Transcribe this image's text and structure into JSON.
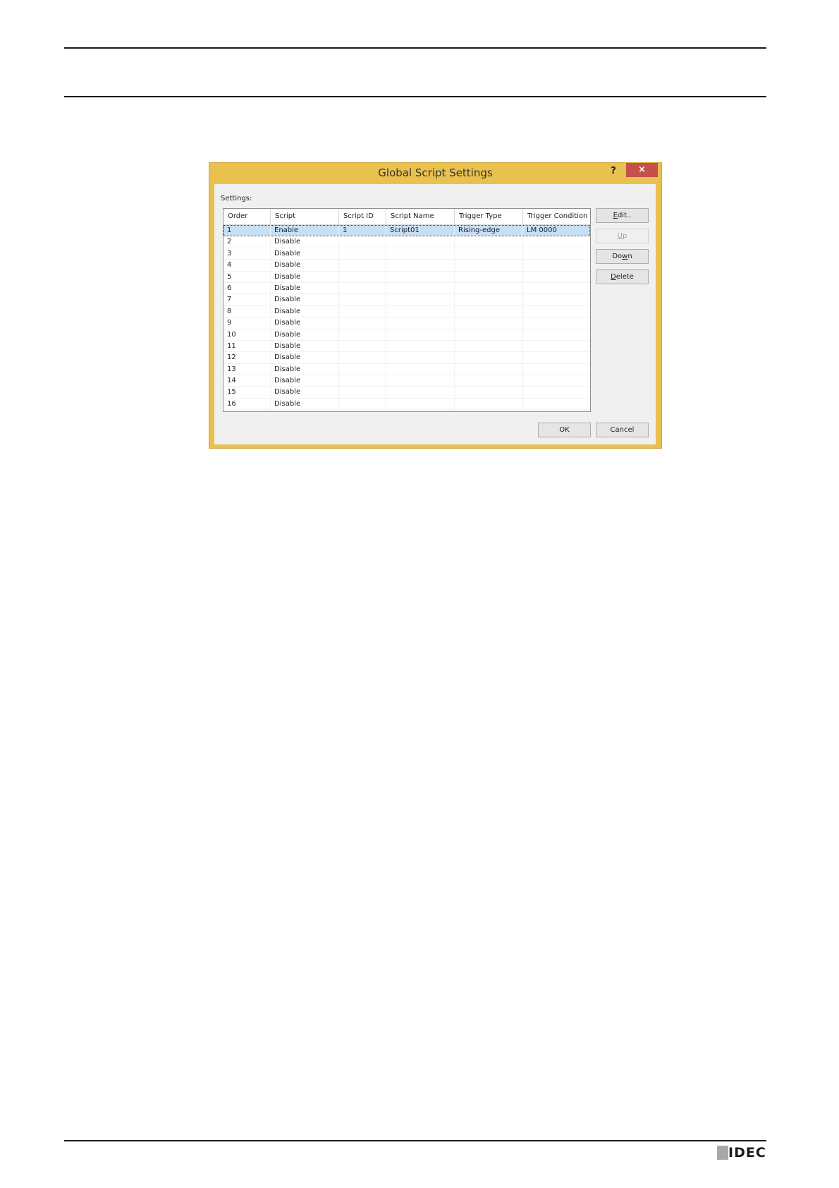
{
  "dialog": {
    "title": "Global Script Settings",
    "help_label": "?",
    "close_label": "×",
    "settings_label": "Settings:",
    "columns": [
      "Order",
      "Script",
      "Script ID",
      "Script Name",
      "Trigger Type",
      "Trigger Condition"
    ],
    "rows": [
      {
        "order": "1",
        "script": "Enable",
        "script_id": "1",
        "script_name": "Script01",
        "trigger_type": "Rising-edge",
        "trigger_condition": "LM 0000"
      },
      {
        "order": "2",
        "script": "Disable",
        "script_id": "",
        "script_name": "",
        "trigger_type": "",
        "trigger_condition": ""
      },
      {
        "order": "3",
        "script": "Disable",
        "script_id": "",
        "script_name": "",
        "trigger_type": "",
        "trigger_condition": ""
      },
      {
        "order": "4",
        "script": "Disable",
        "script_id": "",
        "script_name": "",
        "trigger_type": "",
        "trigger_condition": ""
      },
      {
        "order": "5",
        "script": "Disable",
        "script_id": "",
        "script_name": "",
        "trigger_type": "",
        "trigger_condition": ""
      },
      {
        "order": "6",
        "script": "Disable",
        "script_id": "",
        "script_name": "",
        "trigger_type": "",
        "trigger_condition": ""
      },
      {
        "order": "7",
        "script": "Disable",
        "script_id": "",
        "script_name": "",
        "trigger_type": "",
        "trigger_condition": ""
      },
      {
        "order": "8",
        "script": "Disable",
        "script_id": "",
        "script_name": "",
        "trigger_type": "",
        "trigger_condition": ""
      },
      {
        "order": "9",
        "script": "Disable",
        "script_id": "",
        "script_name": "",
        "trigger_type": "",
        "trigger_condition": ""
      },
      {
        "order": "10",
        "script": "Disable",
        "script_id": "",
        "script_name": "",
        "trigger_type": "",
        "trigger_condition": ""
      },
      {
        "order": "11",
        "script": "Disable",
        "script_id": "",
        "script_name": "",
        "trigger_type": "",
        "trigger_condition": ""
      },
      {
        "order": "12",
        "script": "Disable",
        "script_id": "",
        "script_name": "",
        "trigger_type": "",
        "trigger_condition": ""
      },
      {
        "order": "13",
        "script": "Disable",
        "script_id": "",
        "script_name": "",
        "trigger_type": "",
        "trigger_condition": ""
      },
      {
        "order": "14",
        "script": "Disable",
        "script_id": "",
        "script_name": "",
        "trigger_type": "",
        "trigger_condition": ""
      },
      {
        "order": "15",
        "script": "Disable",
        "script_id": "",
        "script_name": "",
        "trigger_type": "",
        "trigger_condition": ""
      },
      {
        "order": "16",
        "script": "Disable",
        "script_id": "",
        "script_name": "",
        "trigger_type": "",
        "trigger_condition": ""
      }
    ],
    "selected_row": 0,
    "buttons": {
      "edit": {
        "mnemonic": "E",
        "rest": "dit.."
      },
      "up": {
        "mnemonic": "U",
        "rest": "p"
      },
      "down": {
        "pre": "Do",
        "mnemonic": "w",
        "rest": "n"
      },
      "delete": {
        "mnemonic": "D",
        "rest": "elete"
      },
      "ok": "OK",
      "cancel": "Cancel"
    },
    "colors": {
      "frame": "#e9c14f",
      "close_button": "#c7504b",
      "selection": "#c7dff4"
    }
  },
  "logo": {
    "text": "IDEC"
  }
}
